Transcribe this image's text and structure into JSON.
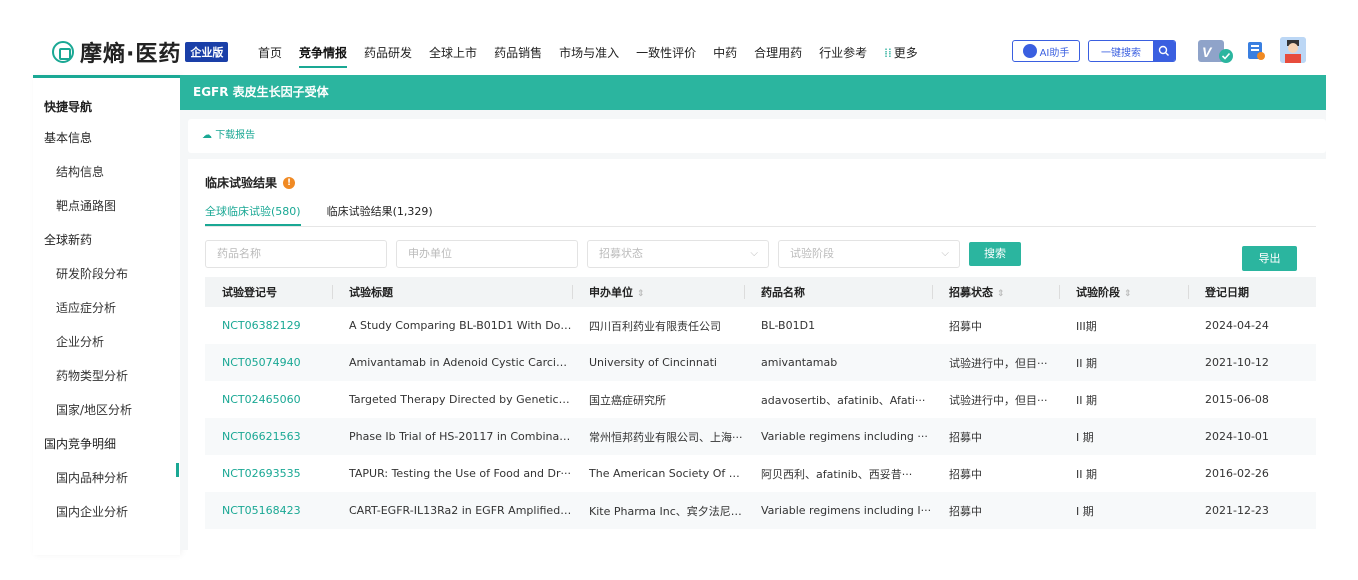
{
  "brand": {
    "name": "摩熵·医药",
    "badge": "企业版",
    "accent": "#1aa894",
    "primary": "#2bb59f"
  },
  "nav": {
    "items": [
      "首页",
      "竞争情报",
      "药品研发",
      "全球上市",
      "药品销售",
      "市场与准入",
      "一致性评价",
      "中药",
      "合理用药",
      "行业参考"
    ],
    "active": "竞争情报",
    "more_label": "更多"
  },
  "header_actions": {
    "ai_label": "AI助手",
    "search_label": "一键搜索"
  },
  "sidebar": {
    "title": "快捷导航",
    "items": [
      {
        "label": "基本信息",
        "level": 0
      },
      {
        "label": "结构信息",
        "level": 1
      },
      {
        "label": "靶点通路图",
        "level": 1
      },
      {
        "label": "全球新药",
        "level": 0
      },
      {
        "label": "研发阶段分布",
        "level": 1
      },
      {
        "label": "适应症分析",
        "level": 1
      },
      {
        "label": "企业分析",
        "level": 1
      },
      {
        "label": "药物类型分析",
        "level": 1
      },
      {
        "label": "国家/地区分析",
        "level": 1
      },
      {
        "label": "国内竞争明细",
        "level": 0
      },
      {
        "label": "国内品种分析",
        "level": 1
      },
      {
        "label": "国内企业分析",
        "level": 1
      }
    ]
  },
  "banner": {
    "title": "EGFR  表皮生长因子受体"
  },
  "toolbar": {
    "download_label": "下载报告"
  },
  "card": {
    "title": "临床试验结果",
    "tabs": [
      {
        "label": "全球临床试验(580)",
        "active": true
      },
      {
        "label": "临床试验结果(1,329)",
        "active": false
      }
    ]
  },
  "filters": {
    "drug_name_placeholder": "药品名称",
    "sponsor_placeholder": "申办单位",
    "status_placeholder": "招募状态",
    "phase_placeholder": "试验阶段",
    "search_label": "搜索",
    "export_label": "导出"
  },
  "table": {
    "columns": [
      "试验登记号",
      "试验标题",
      "申办单位",
      "药品名称",
      "招募状态",
      "试验阶段",
      "登记日期"
    ],
    "sortable": [
      false,
      false,
      true,
      false,
      true,
      true,
      false
    ],
    "rows": [
      [
        "NCT06382129",
        "A Study Comparing BL-B01D1 With Doc···",
        "四川百利药业有限责任公司",
        "BL-B01D1",
        "招募中",
        "III期",
        "2024-04-24"
      ],
      [
        "NCT05074940",
        "Amivantamab in Adenoid Cystic Carcin···",
        "University of Cincinnati",
        "amivantamab",
        "试验进行中，但目···",
        "II 期",
        "2021-10-12"
      ],
      [
        "NCT02465060",
        "Targeted Therapy Directed by Genetic ···",
        "国立癌症研究所",
        "adavosertib、afatinib、Afati···",
        "试验进行中，但目···",
        "II 期",
        "2015-06-08"
      ],
      [
        "NCT06621563",
        "Phase Ib Trial of HS-20117 in Combinat···",
        "常州恒邦药业有限公司、上海···",
        "Variable regimens including ···",
        "招募中",
        "I 期",
        "2024-10-01"
      ],
      [
        "NCT02693535",
        "TAPUR: Testing the Use of Food and Dr···",
        "The American Society Of Clin···",
        "阿贝西利、afatinib、西妥昔···",
        "招募中",
        "II 期",
        "2016-02-26"
      ],
      [
        "NCT05168423",
        "CART-EGFR-IL13Ra2 in EGFR Amplified ···",
        "Kite Pharma Inc、宾夕法尼亚···",
        "Variable regimens including I···",
        "招募中",
        "I 期",
        "2021-12-23"
      ]
    ]
  }
}
